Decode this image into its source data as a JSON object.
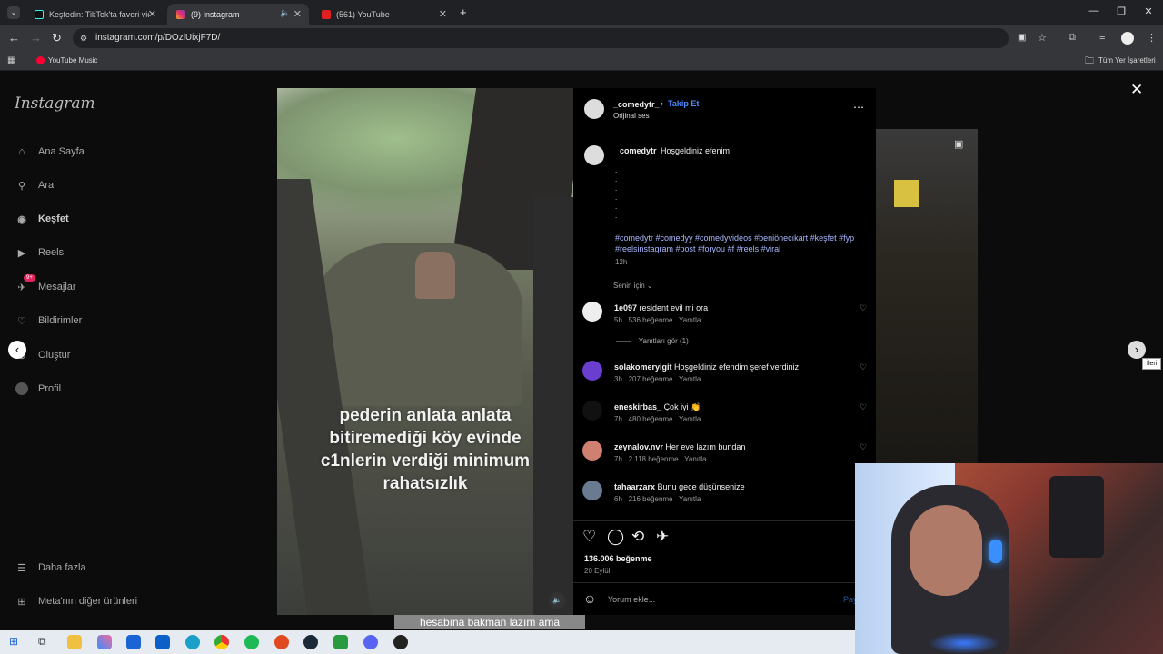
{
  "browser": {
    "tabs": [
      {
        "title": "Keşfedin: TikTok'ta favori videol"
      },
      {
        "title": "(9) Instagram"
      },
      {
        "title": "(561) YouTube"
      }
    ],
    "url": "instagram.com/p/DOzlUixjF7D/",
    "bookmark": "YouTube Music",
    "all_bookmarks": "Tüm Yer İşaretleri"
  },
  "sidebar": {
    "logo": "Instagram",
    "items": [
      {
        "label": "Ana Sayfa"
      },
      {
        "label": "Ara"
      },
      {
        "label": "Keşfet"
      },
      {
        "label": "Reels"
      },
      {
        "label": "Mesajlar",
        "badge": "9+"
      },
      {
        "label": "Bildirimler"
      },
      {
        "label": "Oluştur"
      },
      {
        "label": "Profil"
      }
    ],
    "more": "Daha fazla",
    "meta": "Meta'nın diğer ürünleri"
  },
  "video": {
    "caption": "pederin anlata anlata bitiremediği köy evinde c1nlerin verdiği minimum rahatsızlık",
    "bottom_text": "hesabına bakman lazım ama"
  },
  "post": {
    "author": "_comedytr_",
    "dot": "•",
    "follow": "Takip Et",
    "audio": "Orijinal ses",
    "caption_author": "_comedytr_",
    "caption": "Hoşgeldiniz efenim",
    "dots": ".\n.\n.\n.\n.\n.\n.",
    "hashtags": "#comedytr #comedyy #comedyvideos #beniönecıkart #keşfet #fyp #reelsinstagram #post #foryou #f #reels #viral",
    "time": "12h",
    "sort": "Senin için",
    "view_replies": "Yanıtları gör (1)",
    "likes": "136.006 beğenme",
    "date": "20 Eylül",
    "comment_placeholder": "Yorum ekle...",
    "share": "Pay",
    "tooltip": "İleri"
  },
  "comments": [
    {
      "user": "1e097",
      "text": "resident evil mi ora",
      "time": "5h",
      "likes": "536 beğenme",
      "reply": "Yanıtla"
    },
    {
      "user": "solakomeryigit",
      "text": "Hoşgeldiniz efendim şeref verdiniz",
      "time": "3h",
      "likes": "207 beğenme",
      "reply": "Yanıtla"
    },
    {
      "user": "eneskirbas_",
      "text": "Çok iyi 👏",
      "time": "7h",
      "likes": "480 beğenme",
      "reply": "Yanıtla"
    },
    {
      "user": "zeynalov.nvr",
      "text": "Her eve lazım bundan",
      "time": "7h",
      "likes": "2.118 beğenme",
      "reply": "Yanıtla"
    },
    {
      "user": "tahaarzarx",
      "text": "Bunu gece düşünsenize",
      "time": "6h",
      "likes": "216 beğenme",
      "reply": "Yanıtla"
    }
  ],
  "colors": {
    "accent": "#4a8cff",
    "hashtag": "#a8b8ff",
    "panel": "#000000"
  }
}
